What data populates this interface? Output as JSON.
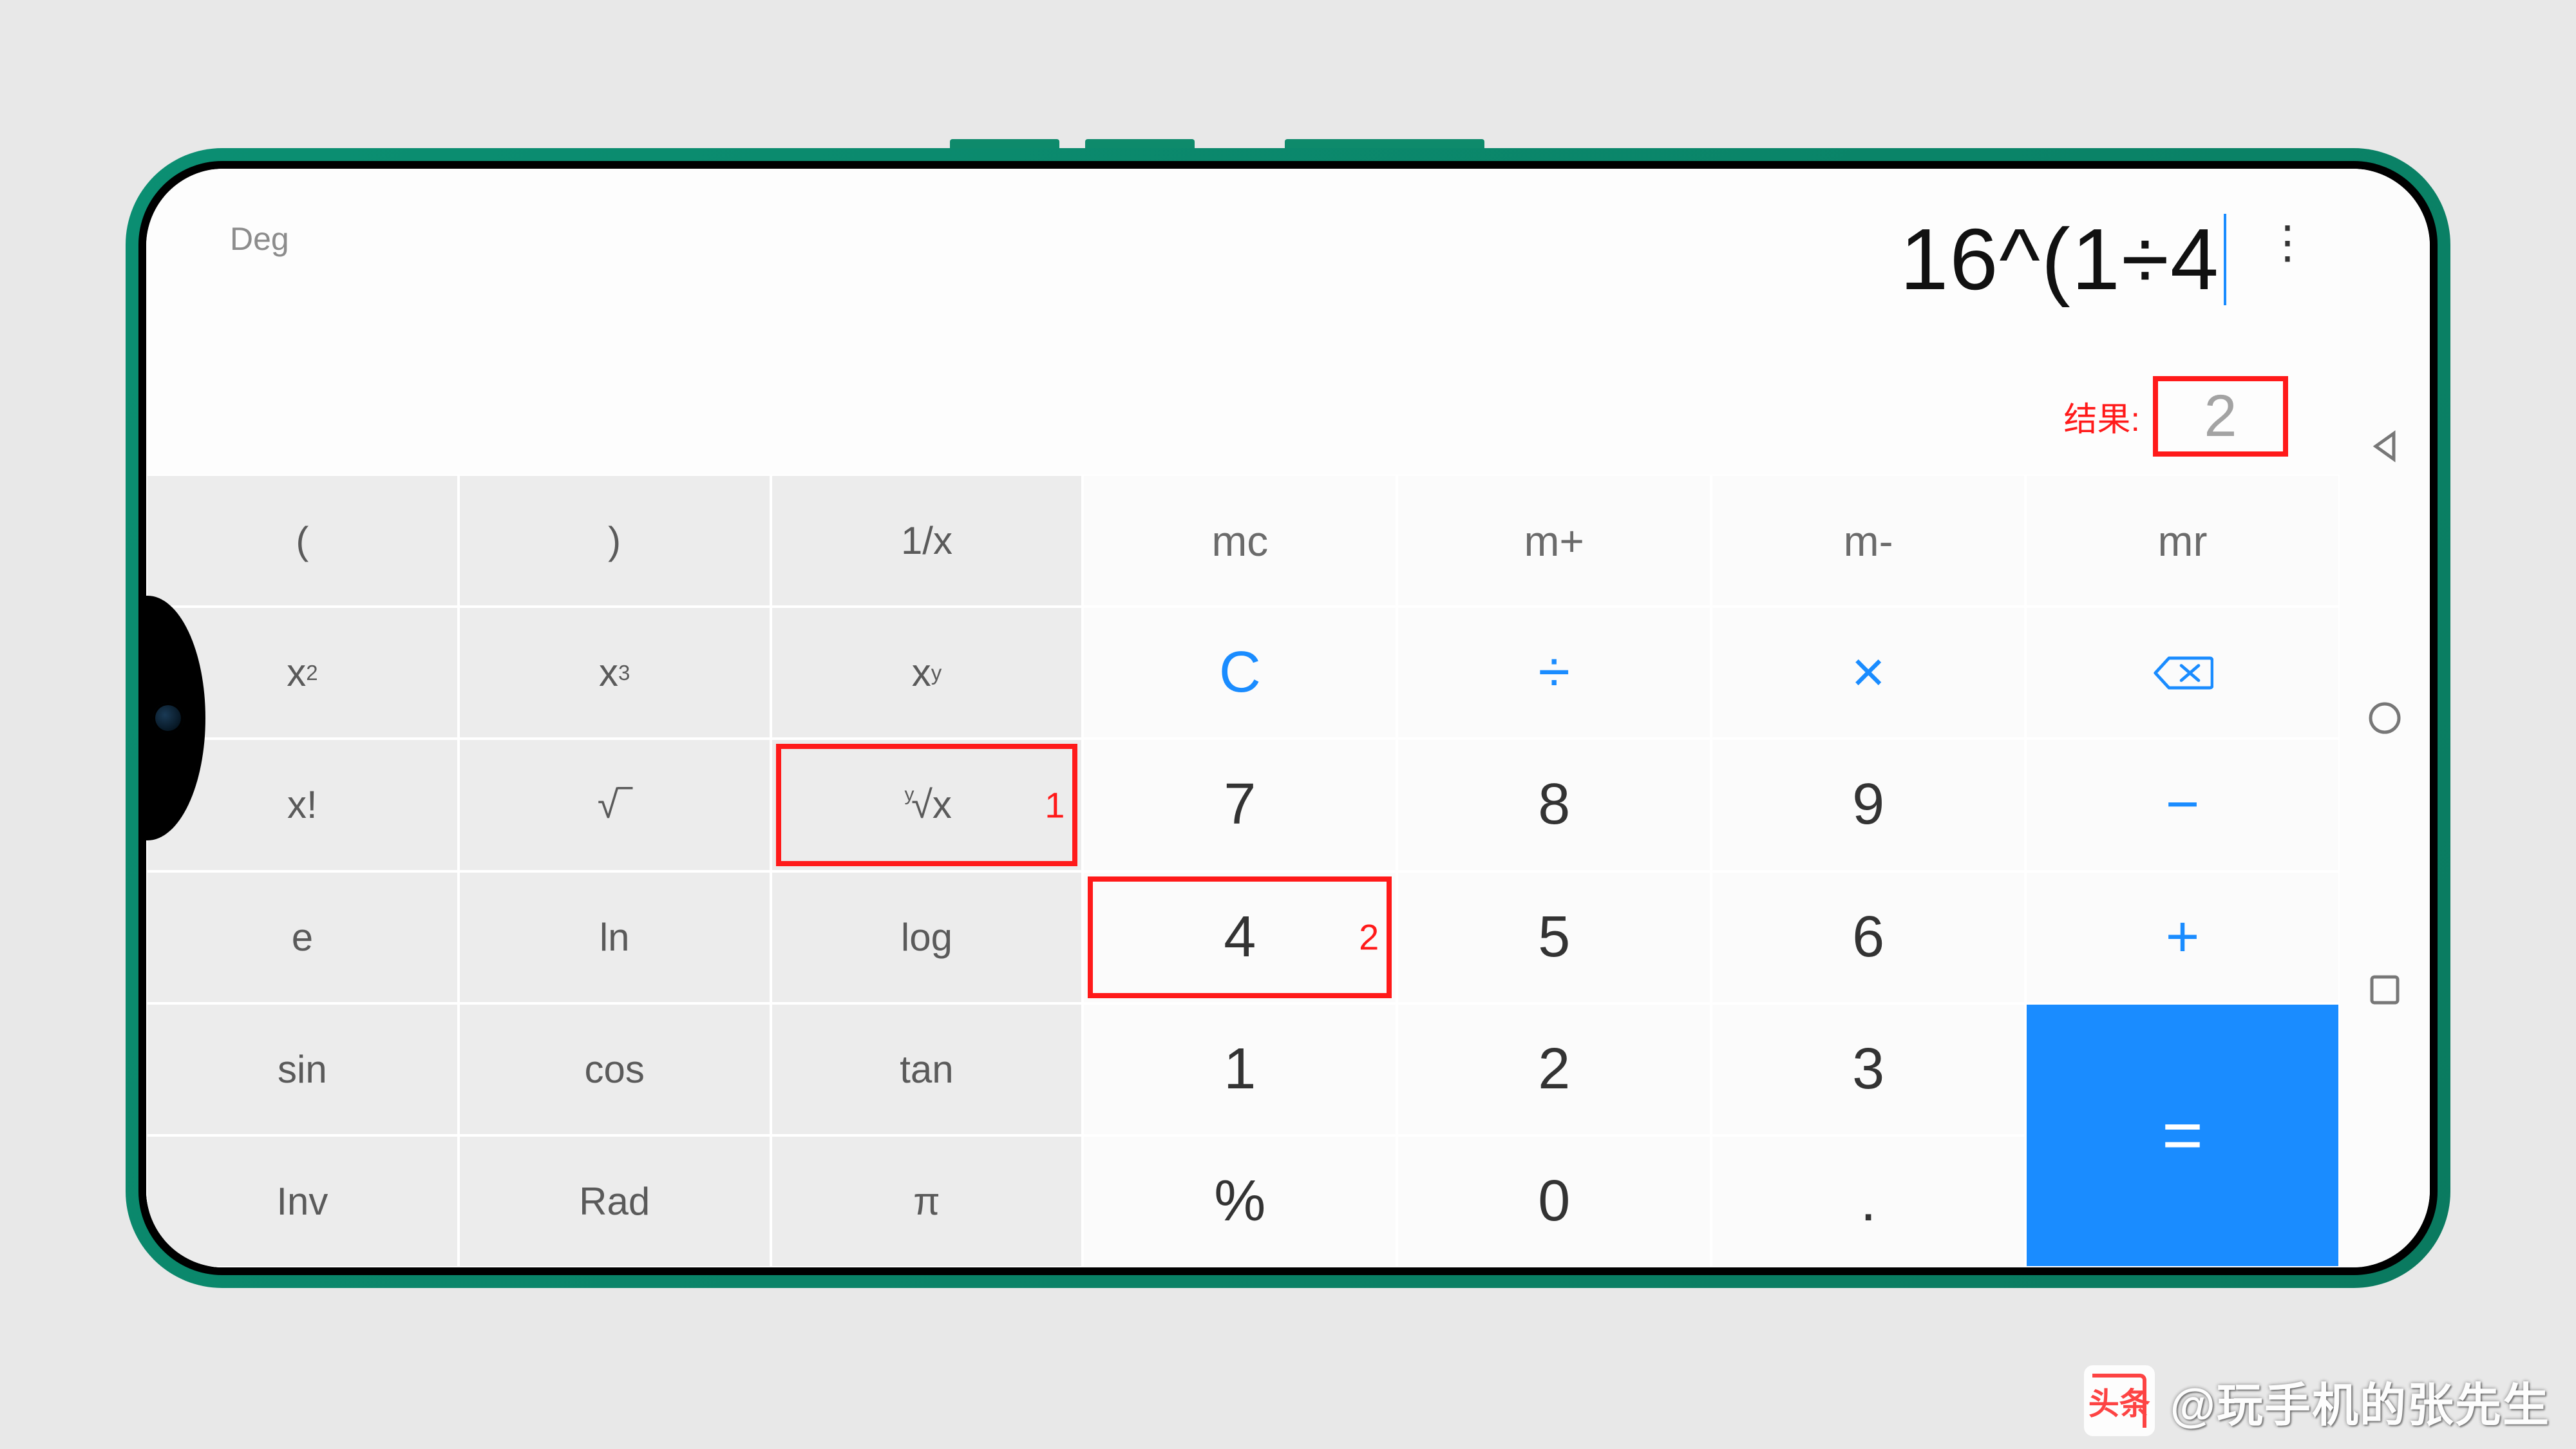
{
  "display": {
    "mode": "Deg",
    "expression": "16^(1÷4",
    "result_label": "结果:",
    "result_value": "2"
  },
  "sci_keys": {
    "row0": {
      "c0": "(",
      "c1": ")",
      "c2": "1/x"
    },
    "row1": {
      "c0": "x²",
      "c1": "x³",
      "c2": "xʸ"
    },
    "row2": {
      "c0": "x!",
      "c1": "√‾",
      "c2": "ʸ√x"
    },
    "row3": {
      "c0": "e",
      "c1": "ln",
      "c2": "log"
    },
    "row4": {
      "c0": "sin",
      "c1": "cos",
      "c2": "tan"
    },
    "row5": {
      "c0": "Inv",
      "c1": "Rad",
      "c2": "π"
    }
  },
  "num_keys": {
    "row0": {
      "c0": "mc",
      "c1": "m+",
      "c2": "m-",
      "c3": "mr"
    },
    "row1": {
      "c0": "C",
      "c1": "÷",
      "c2": "×",
      "c3": "⌫"
    },
    "row2": {
      "c0": "7",
      "c1": "8",
      "c2": "9",
      "c3": "−"
    },
    "row3": {
      "c0": "4",
      "c1": "5",
      "c2": "6",
      "c3": "+"
    },
    "row4": {
      "c0": "1",
      "c1": "2",
      "c2": "3",
      "c3": "="
    },
    "row5": {
      "c0": "%",
      "c1": "0",
      "c2": "."
    }
  },
  "annotations": {
    "nth_root_badge": "1",
    "digit4_badge": "2"
  },
  "watermark": {
    "logo_text": "头条",
    "text": "@玩手机的张先生"
  }
}
